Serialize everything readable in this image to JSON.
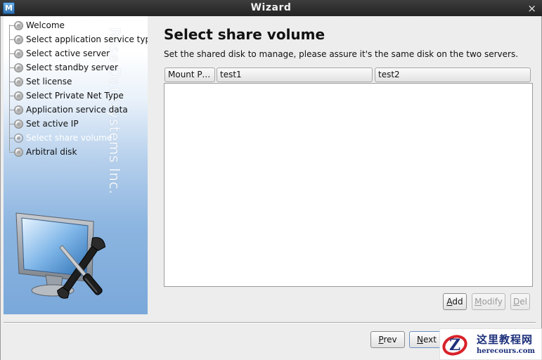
{
  "window": {
    "app_icon_letter": "M",
    "title": "Wizard",
    "close_glyph": "×"
  },
  "sidebar": {
    "brand_vertical": "Rose Datasystems Inc.",
    "steps": [
      {
        "label": "Welcome",
        "active": false
      },
      {
        "label": "Select application service type",
        "active": false
      },
      {
        "label": "Select active server",
        "active": false
      },
      {
        "label": "Select standby server",
        "active": false
      },
      {
        "label": "Set license",
        "active": false
      },
      {
        "label": "Select Private Net Type",
        "active": false
      },
      {
        "label": "Application service data",
        "active": false
      },
      {
        "label": "Set active IP",
        "active": false
      },
      {
        "label": "Select share volume",
        "active": true
      },
      {
        "label": "Arbitral disk",
        "active": false
      }
    ],
    "illustration": "monitor-with-wrench-and-screwdriver-icon"
  },
  "main": {
    "title": "Select share volume",
    "description": "Set the shared disk to manage, please assure it's the same disk on the two servers.",
    "table": {
      "columns": [
        "Mount Po...",
        "test1",
        "test2"
      ],
      "rows": []
    },
    "table_buttons": {
      "add": {
        "label": "Add",
        "mnemonic": "A",
        "rest": "dd",
        "enabled": true
      },
      "modify": {
        "label": "Modify",
        "mnemonic": "M",
        "rest": "odify",
        "enabled": false
      },
      "del": {
        "label": "Del",
        "mnemonic": "D",
        "rest": "el",
        "enabled": false
      }
    }
  },
  "footer": {
    "prev": {
      "label": "Prev",
      "mnemonic": "P",
      "rest": "rev"
    },
    "next": {
      "label": "Next",
      "mnemonic": "N",
      "rest": "ext"
    }
  },
  "watermark": {
    "cn_text": "这里教程网",
    "en_text": "herecours.com",
    "logo_letter": "Z"
  },
  "colors": {
    "titlebar": "#2e2e2e",
    "sidebar_gradient_end": "#7aa8da",
    "window_bg": "#ededed",
    "watermark_text": "#1c2f7a",
    "watermark_logo_red": "#d8222a"
  }
}
